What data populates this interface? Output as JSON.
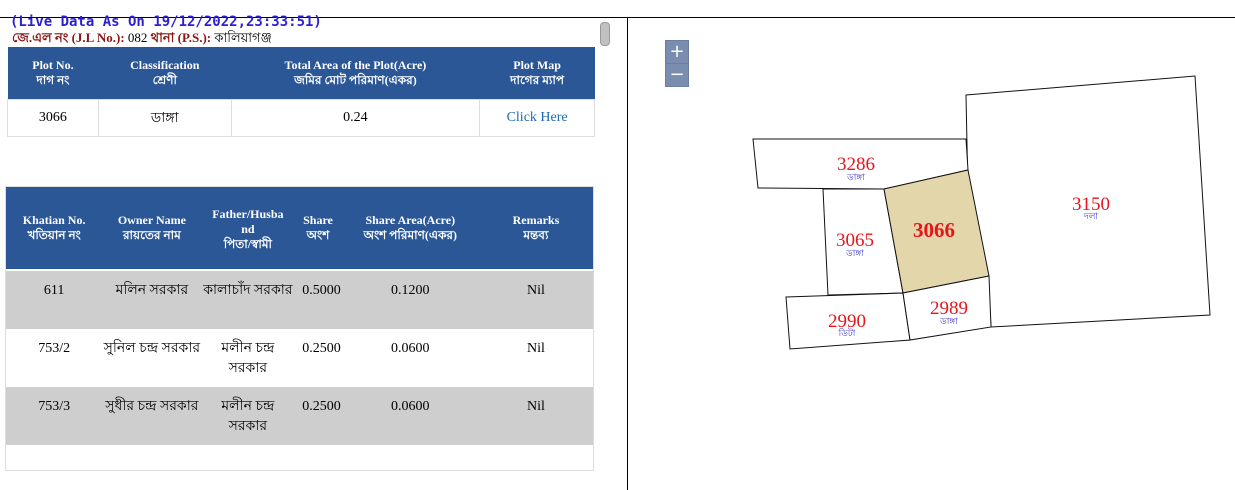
{
  "header": {
    "live": "(Live Data As On 19/12/2022,23:33:51)",
    "jl_label": "জে.এল নং (J.L No.):",
    "jl_value": " 082 ",
    "ps_label": "থানা (P.S.):",
    "ps_value": " কালিয়াগঞ্জ"
  },
  "plot_table": {
    "headers": [
      {
        "en": "Plot No.",
        "bn": "দাগ নং"
      },
      {
        "en": "Classification",
        "bn": "শ্রেণী"
      },
      {
        "en": "Total Area of the Plot(Acre)",
        "bn": "জমির মোট পরিমাণ(একর)"
      },
      {
        "en": "Plot Map",
        "bn": "দাগের ম্যাপ"
      }
    ],
    "row": {
      "plot_no": "3066",
      "classification": "ডাঙ্গা",
      "area": "0.24",
      "map_link": "Click Here"
    }
  },
  "owner_table": {
    "headers": [
      {
        "en": "Khatian No.",
        "bn": "খতিয়ান নং"
      },
      {
        "en": "Owner Name",
        "bn": "রায়তের নাম"
      },
      {
        "en": "Father/Husba nd",
        "bn": "পিতা/স্বামী"
      },
      {
        "en": "Share",
        "bn": "অংশ"
      },
      {
        "en": "Share Area(Acre)",
        "bn": "অংশ পরিমাণ(একর)"
      },
      {
        "en": "Remarks",
        "bn": "মন্তব্য"
      }
    ],
    "rows": [
      {
        "khatian": "611",
        "owner": "মলিন সরকার",
        "father": "কালাচাঁদ সরকার",
        "share": "0.5000",
        "share_area": "0.1200",
        "remarks": "Nil"
      },
      {
        "khatian": "753/2",
        "owner": "সুনিল চন্দ্র সরকার",
        "father": "মলীন চন্দ্র সরকার",
        "share": "0.2500",
        "share_area": "0.0600",
        "remarks": "Nil"
      },
      {
        "khatian": "753/3",
        "owner": "সুধীর চন্দ্র সরকার",
        "father": "মলীন চন্দ্র সরকার",
        "share": "0.2500",
        "share_area": "0.0600",
        "remarks": "Nil"
      }
    ]
  },
  "map": {
    "zoom_in": "+",
    "zoom_out": "−",
    "highlight_color": "#e2d6aa",
    "plots": [
      {
        "no": "3286",
        "type": "ডাঙ্গা"
      },
      {
        "no": "3065",
        "type": "ডাঙ্গা"
      },
      {
        "no": "3066",
        "type": ""
      },
      {
        "no": "3150",
        "type": "দলা"
      },
      {
        "no": "2990",
        "type": "ডিটা"
      },
      {
        "no": "2989",
        "type": "ডাঙ্গা"
      }
    ]
  }
}
